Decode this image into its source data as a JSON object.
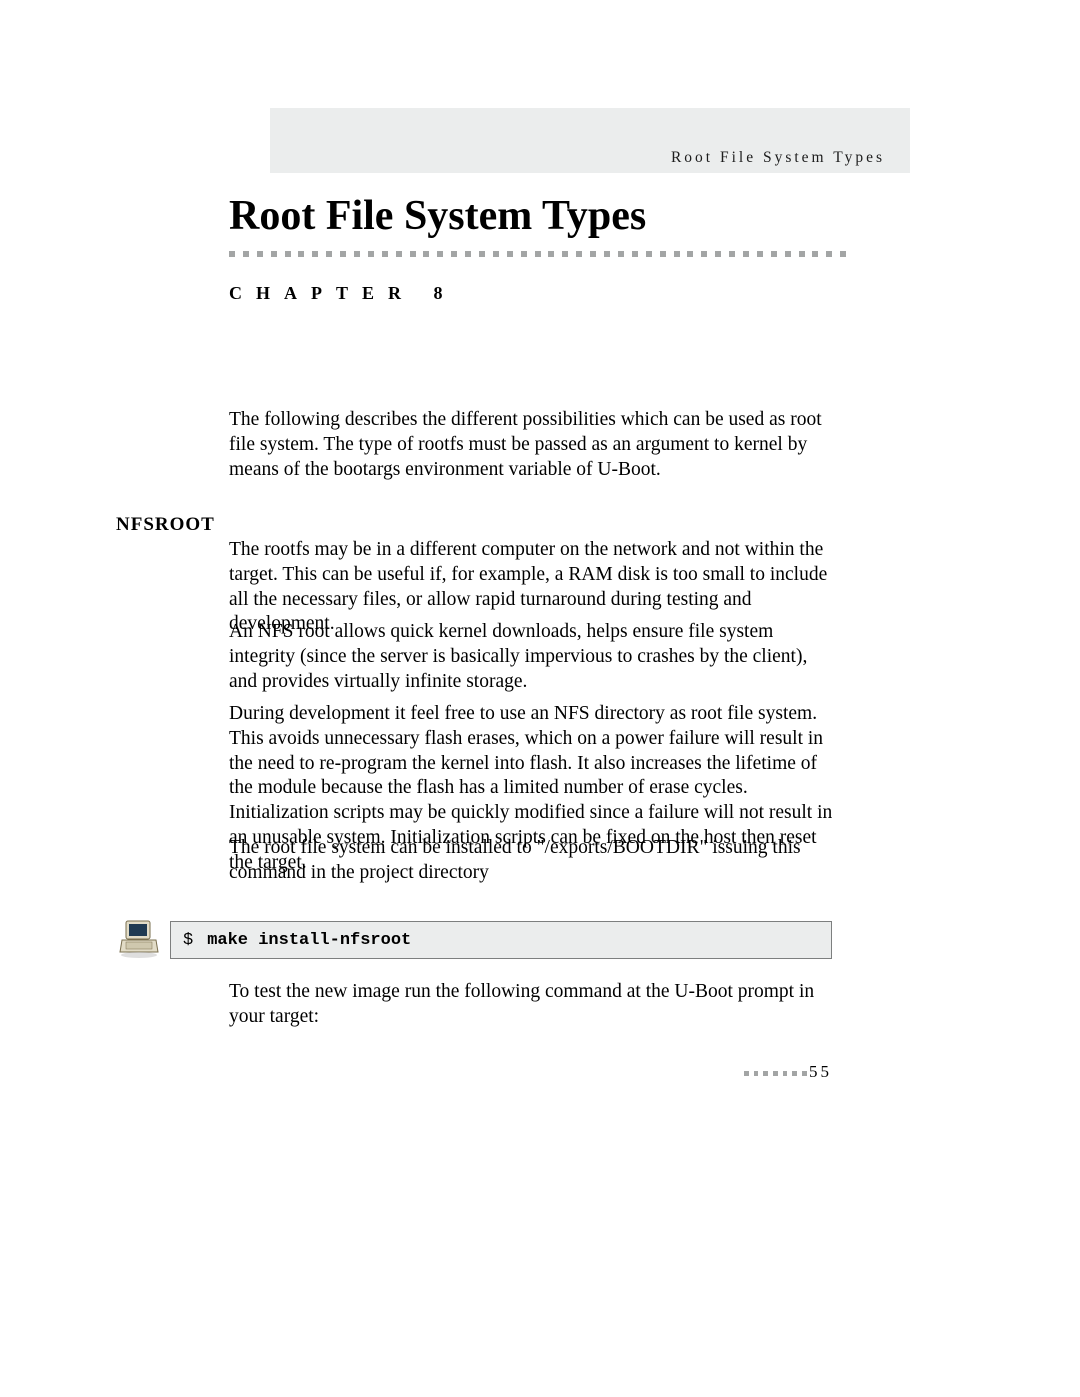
{
  "header": {
    "running_head": "Root File System Types"
  },
  "title": "Root File System Types",
  "chapter_label": "CHAPTER 8",
  "intro_paragraph": "The following describes the different possibilities which can be used as root file system. The type of rootfs must be passed as an argument to kernel by means of the bootargs environment variable of U-Boot.",
  "sections": {
    "nfsroot": {
      "heading": "NFSROOT",
      "paragraphs": [
        "The rootfs may be in a different computer on the network and not within the target. This can be useful if, for example, a RAM disk is too small to include all the necessary files, or allow rapid turnaround during testing and development.",
        "An NFS root allows quick kernel downloads, helps ensure file system integrity (since the server is basically impervious to crashes by the client), and provides virtually infinite storage.",
        "During development it feel free to use an NFS directory as root file system. This avoids unnecessary flash erases, which on a power failure will result in the need to re-program the kernel into flash. It also increases the lifetime of the module because the flash has a limited number of erase cycles. Initialization scripts may be quickly modified since a failure will not result in an unusable system. Initialization scripts can be fixed on the host then reset the target.",
        "The root file system can be installed to \"/exports/BOOTDIR\" issuing this command in the project directory"
      ],
      "command": {
        "prompt": "$",
        "text": "make install-nfsroot"
      },
      "after_command": "To test the new image run the following command at the U-Boot prompt in your target:"
    }
  },
  "page_number": "55"
}
